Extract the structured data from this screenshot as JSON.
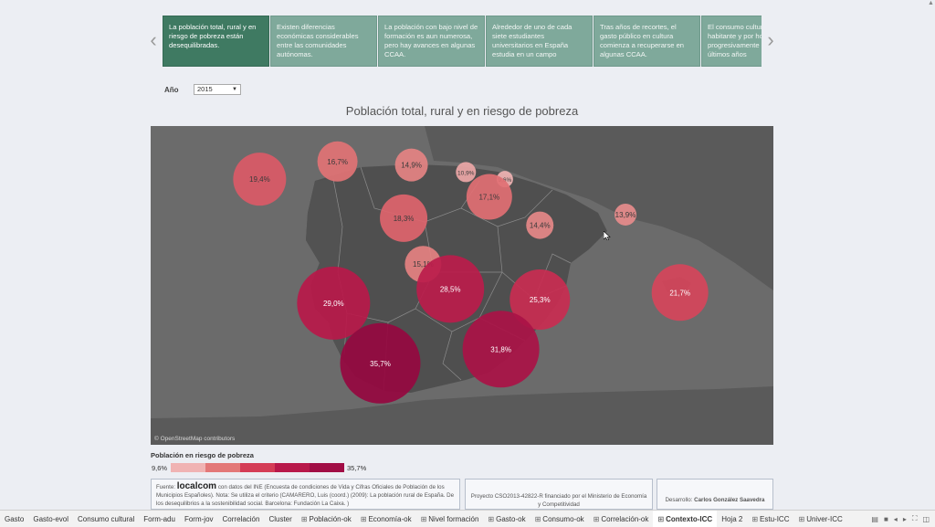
{
  "story": {
    "points": [
      {
        "text": "La población total, rural y en riesgo de pobreza están desequilibradas.",
        "active": true
      },
      {
        "text": "Existen diferencias económicas considerables entre las comunidades autónomas.",
        "active": false
      },
      {
        "text": "La población con bajo nivel de formación es aun numerosa, pero hay avances en algunas CCAA.",
        "active": false
      },
      {
        "text": "Alrededor de uno de cada siete estudiantes universitarios en España estudia en un campo",
        "active": false
      },
      {
        "text": "Tras años de recortes, el gasto público en cultura comienza a recuperarse en algunas CCAA.",
        "active": false
      },
      {
        "text": "El consumo cultural por habitante y por hogar ha caído progresivamente en los últimos años",
        "active": false
      }
    ],
    "prev_arrow": "‹",
    "next_arrow": "›"
  },
  "filter": {
    "label": "Año",
    "value": "2015"
  },
  "chart_data": {
    "type": "scatter",
    "title": "Población total, rural y en riesgo de pobreza",
    "legend_title": "Población en riesgo de pobreza",
    "color_range": [
      9.6,
      35.7
    ],
    "color_range_labels": [
      "9,6%",
      "35,7%"
    ],
    "color_steps": [
      "#f0b3b3",
      "#e37878",
      "#d43c56",
      "#b8184a",
      "#a10d45"
    ],
    "points": [
      {
        "label": "19,4%",
        "value": 19.4,
        "lon": -7.9,
        "lat": 42.8,
        "size": 29
      },
      {
        "label": "16,7%",
        "value": 16.7,
        "lon": -5.9,
        "lat": 43.3,
        "size": 22
      },
      {
        "label": "14,9%",
        "value": 14.9,
        "lon": -4.0,
        "lat": 43.2,
        "size": 18
      },
      {
        "label": "10,9%",
        "value": 10.9,
        "lon": -2.6,
        "lat": 43.0,
        "size": 11
      },
      {
        "label": "9,6%",
        "value": 9.6,
        "lon": -1.6,
        "lat": 42.8,
        "size": 9
      },
      {
        "label": "17,1%",
        "value": 17.1,
        "lon": -2.0,
        "lat": 42.3,
        "size": 25
      },
      {
        "label": "13,9%",
        "value": 13.9,
        "lon": 1.5,
        "lat": 41.8,
        "size": 12
      },
      {
        "label": "18,3%",
        "value": 18.3,
        "lon": -4.2,
        "lat": 41.7,
        "size": 26
      },
      {
        "label": "14,4%",
        "value": 14.4,
        "lon": -0.7,
        "lat": 41.5,
        "size": 15
      },
      {
        "label": "15,1%",
        "value": 15.1,
        "lon": -3.7,
        "lat": 40.4,
        "size": 20
      },
      {
        "label": "28,5%",
        "value": 28.5,
        "lon": -3.0,
        "lat": 39.7,
        "size": 37
      },
      {
        "label": "25,3%",
        "value": 25.3,
        "lon": -0.7,
        "lat": 39.4,
        "size": 33
      },
      {
        "label": "29,0%",
        "value": 29.0,
        "lon": -6.0,
        "lat": 39.3,
        "size": 40
      },
      {
        "label": "21,7%",
        "value": 21.7,
        "lon": 2.9,
        "lat": 39.6,
        "size": 31
      },
      {
        "label": "35,7%",
        "value": 35.7,
        "lon": -4.8,
        "lat": 37.6,
        "size": 44
      },
      {
        "label": "31,8%",
        "value": 31.8,
        "lon": -1.7,
        "lat": 38.0,
        "size": 42
      }
    ]
  },
  "map": {
    "attribution": "© OpenStreetMap contributors"
  },
  "footer": {
    "source_prefix": "Fuente:",
    "source_logo": "localcom",
    "source_text": "con datos del INE (Encuesta de condiciones de Vida y Cifras Oficiales de Población de los Municipios Españoles). Nota: Se utiliza el criterio (CAMARERO, Luis (coord.) (2009): La población rural de España. De los desequilibrios a la sostenibilidad social. Barcelona: Fundación La Caixa. )",
    "project_text": "Proyecto CSO2013-42822-R financiado por el Ministerio de Economía y Competitividad",
    "author_prefix": "Desarrollo:",
    "author_name": "Carlos González Saavedra"
  },
  "tabs": [
    {
      "label": "Gasto",
      "icon": false,
      "active": false
    },
    {
      "label": "Gasto-evol",
      "icon": false,
      "active": false
    },
    {
      "label": "Consumo cultural",
      "icon": false,
      "active": false
    },
    {
      "label": "Form-adu",
      "icon": false,
      "active": false
    },
    {
      "label": "Form-jov",
      "icon": false,
      "active": false
    },
    {
      "label": "Correlación",
      "icon": false,
      "active": false
    },
    {
      "label": "Cluster",
      "icon": false,
      "active": false
    },
    {
      "label": "Población-ok",
      "icon": true,
      "active": false
    },
    {
      "label": "Economía-ok",
      "icon": true,
      "active": false
    },
    {
      "label": "Nivel formación",
      "icon": true,
      "active": false
    },
    {
      "label": "Gasto-ok",
      "icon": true,
      "active": false
    },
    {
      "label": "Consumo-ok",
      "icon": true,
      "active": false
    },
    {
      "label": "Correlación-ok",
      "icon": true,
      "active": false
    },
    {
      "label": "Contexto-ICC",
      "icon": true,
      "active": true
    },
    {
      "label": "Hoja 2",
      "icon": false,
      "active": false
    },
    {
      "label": "Estu-ICC",
      "icon": true,
      "active": false
    },
    {
      "label": "Univer-ICC",
      "icon": true,
      "active": false
    }
  ],
  "tab_controls": [
    "▤",
    "■",
    "◂",
    "▸",
    "⛶",
    "◫"
  ]
}
